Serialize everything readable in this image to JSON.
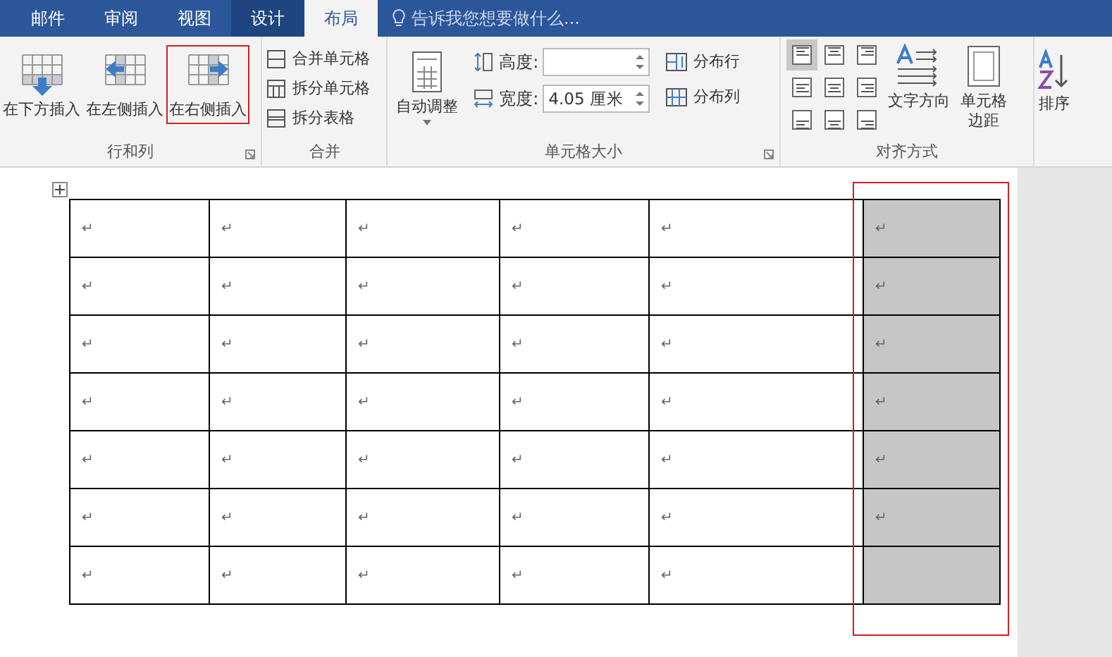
{
  "tabs": [
    {
      "label": "邮件",
      "selected": false,
      "contextual": false
    },
    {
      "label": "审阅",
      "selected": false,
      "contextual": false
    },
    {
      "label": "视图",
      "selected": false,
      "contextual": false
    },
    {
      "label": "设计",
      "selected": false,
      "contextual": true
    },
    {
      "label": "布局",
      "selected": true,
      "contextual": true
    }
  ],
  "search": {
    "placeholder": "告诉我您想要做什么..."
  },
  "groups": [
    {
      "kind": "rows_columns",
      "label": "行和列",
      "buttons": [
        {
          "label": "在下方插入",
          "outlined": false
        },
        {
          "label": "在左侧插入",
          "outlined": false
        },
        {
          "label": "在右侧插入",
          "outlined": true
        }
      ]
    },
    {
      "kind": "merge",
      "label": "合并",
      "items": [
        "合并单元格",
        "拆分单元格",
        "拆分表格"
      ]
    },
    {
      "kind": "cell_size",
      "label": "单元格大小",
      "autofit": "自动调整",
      "height": {
        "label": "高度:"
      },
      "width": {
        "label": "宽度:",
        "value": "4.05 厘米"
      },
      "distribute": [
        "分布行",
        "分布列"
      ]
    },
    {
      "kind": "alignment",
      "label": "对齐方式",
      "align": [
        {
          "selected": true
        },
        {
          "selected": false
        },
        {
          "selected": false
        },
        {
          "selected": false
        },
        {
          "selected": false
        },
        {
          "selected": false
        },
        {
          "selected": false
        },
        {
          "selected": false
        },
        {
          "selected": false
        }
      ],
      "direction": "文字方向",
      "margins": "单元格边距"
    },
    {
      "kind": "sort",
      "label_top": "排序"
    }
  ],
  "table": {
    "columns": [
      {
        "selected": false,
        "outlined": false
      },
      {
        "selected": false,
        "outlined": false
      },
      {
        "selected": false,
        "outlined": false
      },
      {
        "selected": false,
        "outlined": false
      },
      {
        "selected": false,
        "outlined": false
      },
      {
        "selected": true,
        "outlined": true
      }
    ],
    "rows": [
      {
        "cells": [
          "↵",
          "↵",
          "↵",
          "↵",
          "↵",
          "↵"
        ]
      },
      {
        "cells": [
          "↵",
          "↵",
          "↵",
          "↵",
          "↵",
          "↵"
        ]
      },
      {
        "cells": [
          "↵",
          "↵",
          "↵",
          "↵",
          "↵",
          "↵"
        ]
      },
      {
        "cells": [
          "↵",
          "↵",
          "↵",
          "↵",
          "↵",
          "↵"
        ]
      },
      {
        "cells": [
          "↵",
          "↵",
          "↵",
          "↵",
          "↵",
          "↵"
        ]
      },
      {
        "cells": [
          "↵",
          "↵",
          "↵",
          "↵",
          "↵",
          "↵"
        ]
      },
      {
        "cells": [
          "↵",
          "↵",
          "↵",
          "↵",
          "↵"
        ]
      }
    ]
  }
}
